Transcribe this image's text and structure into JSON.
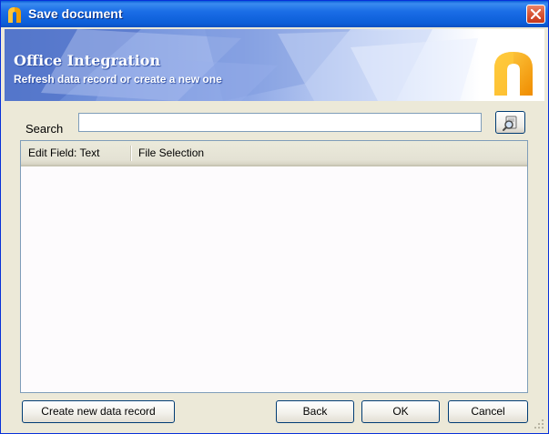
{
  "window": {
    "title": "Save document"
  },
  "banner": {
    "title": "Office Integration",
    "subtitle": "Refresh data record or create a new one"
  },
  "search": {
    "label": "Search",
    "value": "",
    "placeholder": ""
  },
  "grid": {
    "columns": [
      "Edit Field: Text",
      "File Selection"
    ],
    "rows": []
  },
  "buttons": {
    "create": "Create new data record",
    "back": "Back",
    "ok": "OK",
    "cancel": "Cancel"
  },
  "colors": {
    "titlebar": "#0a5fd8",
    "brand_orange": "#f5a000",
    "close_red": "#d95a3a",
    "dialog_bg": "#ece9d8"
  },
  "icons": {
    "title": "app-logo-icon",
    "close": "close-icon",
    "search": "search-icon",
    "brand": "brand-logo-icon",
    "grip": "resize-grip-icon"
  }
}
